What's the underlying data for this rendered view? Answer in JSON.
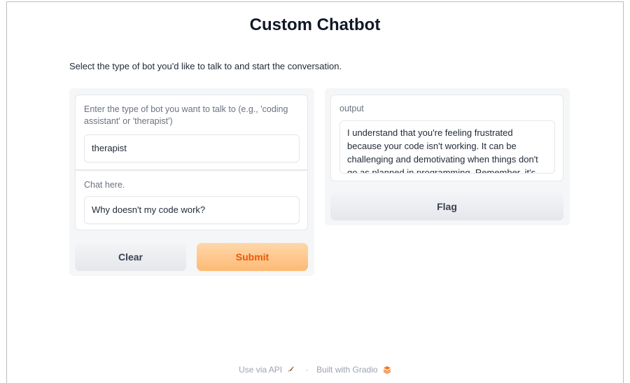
{
  "header": {
    "title": "Custom Chatbot",
    "subtitle": "Select the type of bot you'd like to talk to and start the conversation."
  },
  "inputs": {
    "bot_type": {
      "label": "Enter the type of bot you want to talk to (e.g., 'coding assistant' or 'therapist')",
      "value": "therapist"
    },
    "chat": {
      "label": "Chat here.",
      "value": "Why doesn't my code work?"
    }
  },
  "buttons": {
    "clear": "Clear",
    "submit": "Submit",
    "flag": "Flag"
  },
  "output": {
    "label": "output",
    "text": "I understand that you're feeling frustrated because your code isn't working. It can be challenging and demotivating when things don't go as planned in programming. Remember, it's normal to"
  },
  "footer": {
    "api_link": "Use via API",
    "separator": "·",
    "built_with": "Built with Gradio"
  },
  "colors": {
    "submit_bg": "#fdba74",
    "submit_text": "#ea580c",
    "panel_bg": "#f5f6f8"
  },
  "icons": {
    "api": "rocket-icon",
    "gradio": "gradio-logo-icon"
  }
}
